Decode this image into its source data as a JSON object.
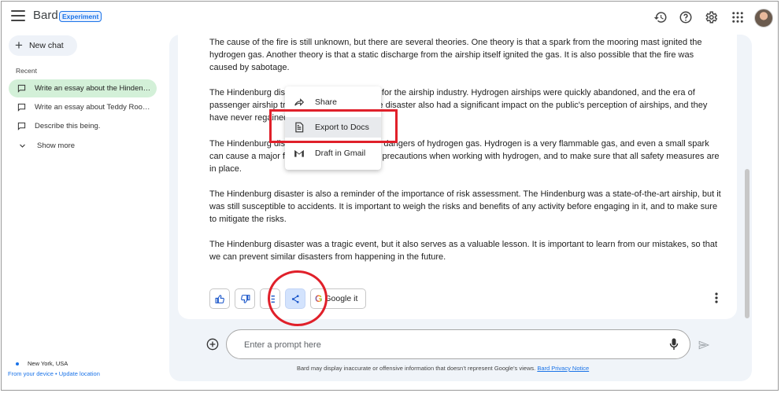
{
  "app": {
    "title": "Bard",
    "badge": "Experiment",
    "icons": [
      "menu-icon",
      "history-icon",
      "help-icon",
      "settings-icon",
      "apps-icon"
    ]
  },
  "sidebar": {
    "new_chat": "New chat",
    "recent_label": "Recent",
    "items": [
      {
        "label": "Write an essay about the Hindenburg disaster",
        "active": true
      },
      {
        "label": "Write an essay about Teddy Roosevelt",
        "active": false
      },
      {
        "label": "Describe this being.",
        "active": false
      }
    ],
    "show_more": "Show more",
    "location": {
      "name": "New York, USA",
      "source": "From your device",
      "separator": "•",
      "update_link": "Update location"
    }
  },
  "response": {
    "paragraphs": [
      "The cause of the fire is still unknown, but there are several theories. One theory is that a spark from the mooring mast ignited the hydrogen gas. Another theory is that a static discharge from the airship itself ignited the gas. It is also possible that the fire was caused by sabotage.",
      "The Hindenburg disaster was a turning point for the airship industry. Hydrogen airships were quickly abandoned, and the era of passenger airship travel came to an end. The disaster also had a significant impact on the public's perception of airships, and they have never regained their popularity.",
      "The Hindenburg disaster also highlighted the dangers of hydrogen gas. Hydrogen is a very flammable gas, and even a small spark can cause a major fire. It is important to take precautions when working with hydrogen, and to make sure that all safety measures are in place.",
      "The Hindenburg disaster is also a reminder of the importance of risk assessment. The Hindenburg was a state-of-the-art airship, but it was still susceptible to accidents. It is important to weigh the risks and benefits of any activity before engaging in it, and to make sure to mitigate the risks.",
      "The Hindenburg disaster was a tragic event, but it also serves as a valuable lesson. It is important to learn from our mistakes, so that we can prevent similar disasters from happening in the future."
    ],
    "actions": {
      "google_it": "Google it",
      "google_g": "G"
    }
  },
  "share_menu": {
    "items": [
      {
        "label": "Share",
        "icon": "share-arrow-icon"
      },
      {
        "label": "Export to Docs",
        "icon": "docs-icon"
      },
      {
        "label": "Draft in Gmail",
        "icon": "gmail-icon"
      }
    ]
  },
  "input": {
    "placeholder": "Enter a prompt here"
  },
  "footer": {
    "disclaimer": "Bard may display inaccurate or offensive information that doesn’t represent Google’s views.",
    "privacy_link": "Bard Privacy Notice"
  },
  "colors": {
    "accent": "#1a73e8",
    "active_chat": "#d3f0d8",
    "annotation_red": "#e0202a",
    "main_bg": "#f0f4f9"
  }
}
